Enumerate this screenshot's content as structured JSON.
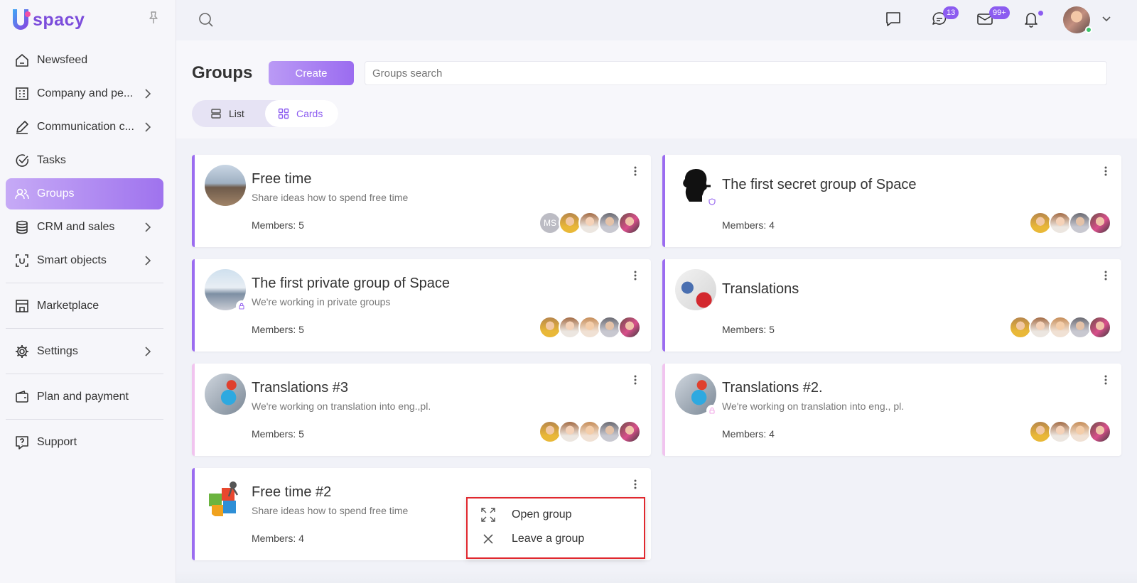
{
  "brand": {
    "logo_text": "spacy"
  },
  "sidebar": {
    "items": [
      {
        "label": "Newsfeed",
        "icon": "home-icon",
        "has_chevron": false,
        "active": false
      },
      {
        "label": "Company and pe...",
        "icon": "building-icon",
        "has_chevron": true,
        "active": false
      },
      {
        "label": "Communication c...",
        "icon": "communication-icon",
        "has_chevron": true,
        "active": false
      },
      {
        "label": "Tasks",
        "icon": "check-circle-icon",
        "has_chevron": false,
        "active": false
      },
      {
        "label": "Groups",
        "icon": "users-icon",
        "has_chevron": false,
        "active": true
      },
      {
        "label": "CRM and sales",
        "icon": "database-icon",
        "has_chevron": true,
        "active": false
      },
      {
        "label": "Smart objects",
        "icon": "scan-icon",
        "has_chevron": true,
        "active": false
      },
      {
        "label": "Marketplace",
        "icon": "store-icon",
        "has_chevron": false,
        "active": false
      },
      {
        "label": "Settings",
        "icon": "gear-icon",
        "has_chevron": true,
        "active": false
      },
      {
        "label": "Plan and payment",
        "icon": "wallet-icon",
        "has_chevron": false,
        "active": false
      },
      {
        "label": "Support",
        "icon": "help-icon",
        "has_chevron": false,
        "active": false
      }
    ]
  },
  "topbar": {
    "chat_badge": "13",
    "mail_badge": "99+",
    "accent_color": "#8c5cf0",
    "online_color": "#3cc46b"
  },
  "header": {
    "title": "Groups",
    "create_label": "Create",
    "search_placeholder": "Groups search",
    "view_list_label": "List",
    "view_cards_label": "Cards"
  },
  "groups": [
    {
      "title": "Free time",
      "description": "Share ideas how to spend free time",
      "members": "Members: 5",
      "locked": false
    },
    {
      "title": "The first secret group of Space",
      "description": "",
      "members": "Members: 4",
      "locked": true
    },
    {
      "title": "The first private group of Space",
      "description": "We're working in private groups",
      "members": "Members: 5",
      "locked": true
    },
    {
      "title": "Translations",
      "description": "",
      "members": "Members: 5",
      "locked": false
    },
    {
      "title": "Translations #3",
      "description": "We're working on translation into eng.,pl.",
      "members": "Members: 5",
      "locked": false
    },
    {
      "title": "Translations #2.",
      "description": "We're working on translation into eng., pl.",
      "members": "Members: 4",
      "locked": true
    },
    {
      "title": "Free time #2",
      "description": "Share ideas how to spend free time",
      "members": "Members: 4",
      "locked": false
    }
  ],
  "member_initials": "MS",
  "context_menu": {
    "open_label": "Open group",
    "leave_label": "Leave a group",
    "highlight_color": "#e0282e"
  }
}
